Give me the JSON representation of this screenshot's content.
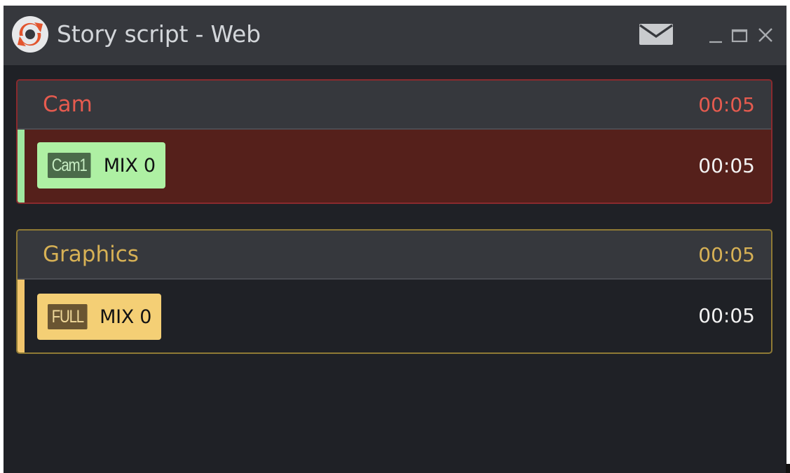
{
  "window": {
    "title": "Story script - Web",
    "icons": {
      "logo": "app-logo-icon",
      "mail": "mail-icon",
      "minimize": "minimize-icon",
      "maximize": "maximize-icon",
      "close": "close-icon"
    }
  },
  "groups": [
    {
      "title": "Cam",
      "duration": "00:05",
      "accent": "#e65b4f",
      "items": [
        {
          "tag": "Cam1",
          "label": "MIX 0",
          "duration": "00:05",
          "chip_color": "#aef0a3"
        }
      ]
    },
    {
      "title": "Graphics",
      "duration": "00:05",
      "accent": "#d7b155",
      "items": [
        {
          "tag": "FULL",
          "label": "MIX 0",
          "duration": "00:05",
          "chip_color": "#f4cf75"
        }
      ]
    }
  ],
  "colors": {
    "background": "#1f2126",
    "titlebar": "#36383d",
    "cam_active_row": "#55201b"
  }
}
